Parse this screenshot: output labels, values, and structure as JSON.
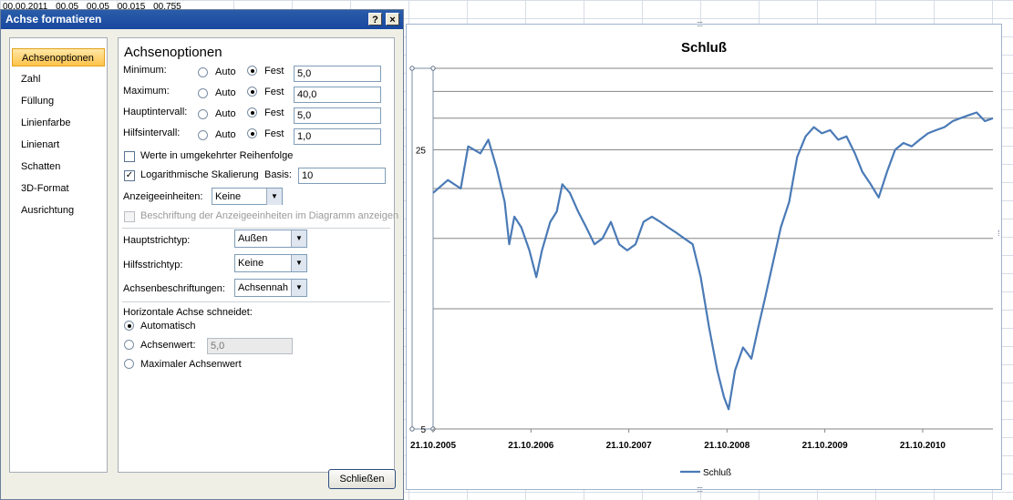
{
  "sheet": {
    "cells": [
      "00.00.2011",
      "00.05",
      "00.05",
      "00.015",
      "00.755"
    ]
  },
  "dialog": {
    "title": "Achse formatieren",
    "help_label": "?",
    "close_label": "×",
    "nav": {
      "items": [
        {
          "label": "Achsenoptionen",
          "selected": true
        },
        {
          "label": "Zahl"
        },
        {
          "label": "Füllung"
        },
        {
          "label": "Linienfarbe"
        },
        {
          "label": "Linienart"
        },
        {
          "label": "Schatten"
        },
        {
          "label": "3D-Format"
        },
        {
          "label": "Ausrichtung"
        }
      ]
    },
    "panel": {
      "title": "Achsenoptionen",
      "rows": [
        {
          "label": "Minimum:",
          "auto_label": "Auto",
          "fixed_label": "Fest",
          "value": "5,0",
          "fixed_selected": true
        },
        {
          "label": "Maximum:",
          "auto_label": "Auto",
          "fixed_label": "Fest",
          "value": "40,0",
          "fixed_selected": true
        },
        {
          "label": "Hauptintervall:",
          "auto_label": "Auto",
          "fixed_label": "Fest",
          "value": "5,0",
          "fixed_selected": true
        },
        {
          "label": "Hilfsintervall:",
          "auto_label": "Auto",
          "fixed_label": "Fest",
          "value": "1,0",
          "fixed_selected": true
        }
      ],
      "reverse_order_label": "Werte in umgekehrter Reihenfolge",
      "reverse_order_checked": false,
      "log_scale_label": "Logarithmische Skalierung",
      "log_scale_checked": true,
      "base_label": "Basis:",
      "base_value": "10",
      "display_units_label": "Anzeigeeinheiten:",
      "display_units_value": "Keine",
      "show_units_label": "Beschriftung der Anzeigeeinheiten im Diagramm anzeigen",
      "major_tick_label": "Hauptstrichtyp:",
      "major_tick_value": "Außen",
      "minor_tick_label": "Hilfsstrichtyp:",
      "minor_tick_value": "Keine",
      "axis_labels_label": "Achsenbeschriftungen:",
      "axis_labels_value": "Achsennah",
      "crosses_heading": "Horizontale Achse schneidet:",
      "crosses_auto_label": "Automatisch",
      "crosses_value_label": "Achsenwert:",
      "crosses_value": "5,0",
      "crosses_max_label": "Maximaler Achsenwert"
    },
    "close_button": "Schließen"
  },
  "chart_data": {
    "type": "line",
    "title": "Schluß",
    "series": [
      {
        "name": "Schluß",
        "color": "#4a7ab6"
      }
    ],
    "x_tick_labels": [
      "21.10.2005",
      "21.10.2006",
      "21.10.2007",
      "21.10.2008",
      "21.10.2009",
      "21.10.2010"
    ],
    "x_range": [
      "2005-10-21",
      "2011-07-10"
    ],
    "y_tick_labels": [
      "25",
      "5"
    ],
    "ylim": [
      5,
      40
    ],
    "y_scale": "log",
    "grid": true,
    "legend": "bottom",
    "points": [
      [
        "2005-10-21",
        19.5
      ],
      [
        "2005-12-15",
        21.0
      ],
      [
        "2006-02-01",
        20.0
      ],
      [
        "2006-03-01",
        25.5
      ],
      [
        "2006-04-15",
        24.5
      ],
      [
        "2006-05-15",
        26.5
      ],
      [
        "2006-06-15",
        22.5
      ],
      [
        "2006-07-15",
        18.5
      ],
      [
        "2006-08-01",
        14.5
      ],
      [
        "2006-08-20",
        17.0
      ],
      [
        "2006-09-15",
        16.0
      ],
      [
        "2006-10-15",
        14.0
      ],
      [
        "2006-11-10",
        12.0
      ],
      [
        "2006-12-01",
        14.0
      ],
      [
        "2007-01-01",
        16.5
      ],
      [
        "2007-01-25",
        17.5
      ],
      [
        "2007-02-15",
        20.5
      ],
      [
        "2007-03-15",
        19.5
      ],
      [
        "2007-04-15",
        17.5
      ],
      [
        "2007-05-15",
        16.0
      ],
      [
        "2007-06-15",
        14.5
      ],
      [
        "2007-07-15",
        15.0
      ],
      [
        "2007-08-15",
        16.5
      ],
      [
        "2007-09-15",
        14.5
      ],
      [
        "2007-10-15",
        14.0
      ],
      [
        "2007-11-15",
        14.5
      ],
      [
        "2007-12-15",
        16.5
      ],
      [
        "2008-01-15",
        17.0
      ],
      [
        "2008-02-15",
        16.5
      ],
      [
        "2008-03-15",
        16.0
      ],
      [
        "2008-04-15",
        15.5
      ],
      [
        "2008-05-15",
        15.0
      ],
      [
        "2008-06-15",
        14.5
      ],
      [
        "2008-07-15",
        12.0
      ],
      [
        "2008-08-15",
        9.0
      ],
      [
        "2008-09-15",
        7.0
      ],
      [
        "2008-10-10",
        6.0
      ],
      [
        "2008-10-27",
        5.6
      ],
      [
        "2008-11-20",
        7.0
      ],
      [
        "2008-12-20",
        8.0
      ],
      [
        "2009-01-20",
        7.5
      ],
      [
        "2009-02-15",
        9.0
      ],
      [
        "2009-03-10",
        10.5
      ],
      [
        "2009-04-10",
        13.0
      ],
      [
        "2009-05-10",
        16.0
      ],
      [
        "2009-06-10",
        18.5
      ],
      [
        "2009-07-10",
        24.0
      ],
      [
        "2009-08-10",
        27.0
      ],
      [
        "2009-09-10",
        28.5
      ],
      [
        "2009-10-10",
        27.5
      ],
      [
        "2009-11-10",
        28.0
      ],
      [
        "2009-12-10",
        26.5
      ],
      [
        "2010-01-10",
        27.0
      ],
      [
        "2010-02-10",
        24.5
      ],
      [
        "2010-03-10",
        22.0
      ],
      [
        "2010-04-10",
        20.5
      ],
      [
        "2010-05-10",
        19.0
      ],
      [
        "2010-06-10",
        22.0
      ],
      [
        "2010-07-10",
        25.0
      ],
      [
        "2010-08-10",
        26.0
      ],
      [
        "2010-09-10",
        25.5
      ],
      [
        "2010-10-10",
        26.5
      ],
      [
        "2010-11-10",
        27.5
      ],
      [
        "2010-12-10",
        28.0
      ],
      [
        "2011-01-10",
        28.5
      ],
      [
        "2011-02-10",
        29.5
      ],
      [
        "2011-03-10",
        30.0
      ],
      [
        "2011-04-10",
        30.5
      ],
      [
        "2011-05-10",
        31.0
      ],
      [
        "2011-06-10",
        29.5
      ],
      [
        "2011-07-10",
        30.0
      ]
    ]
  }
}
